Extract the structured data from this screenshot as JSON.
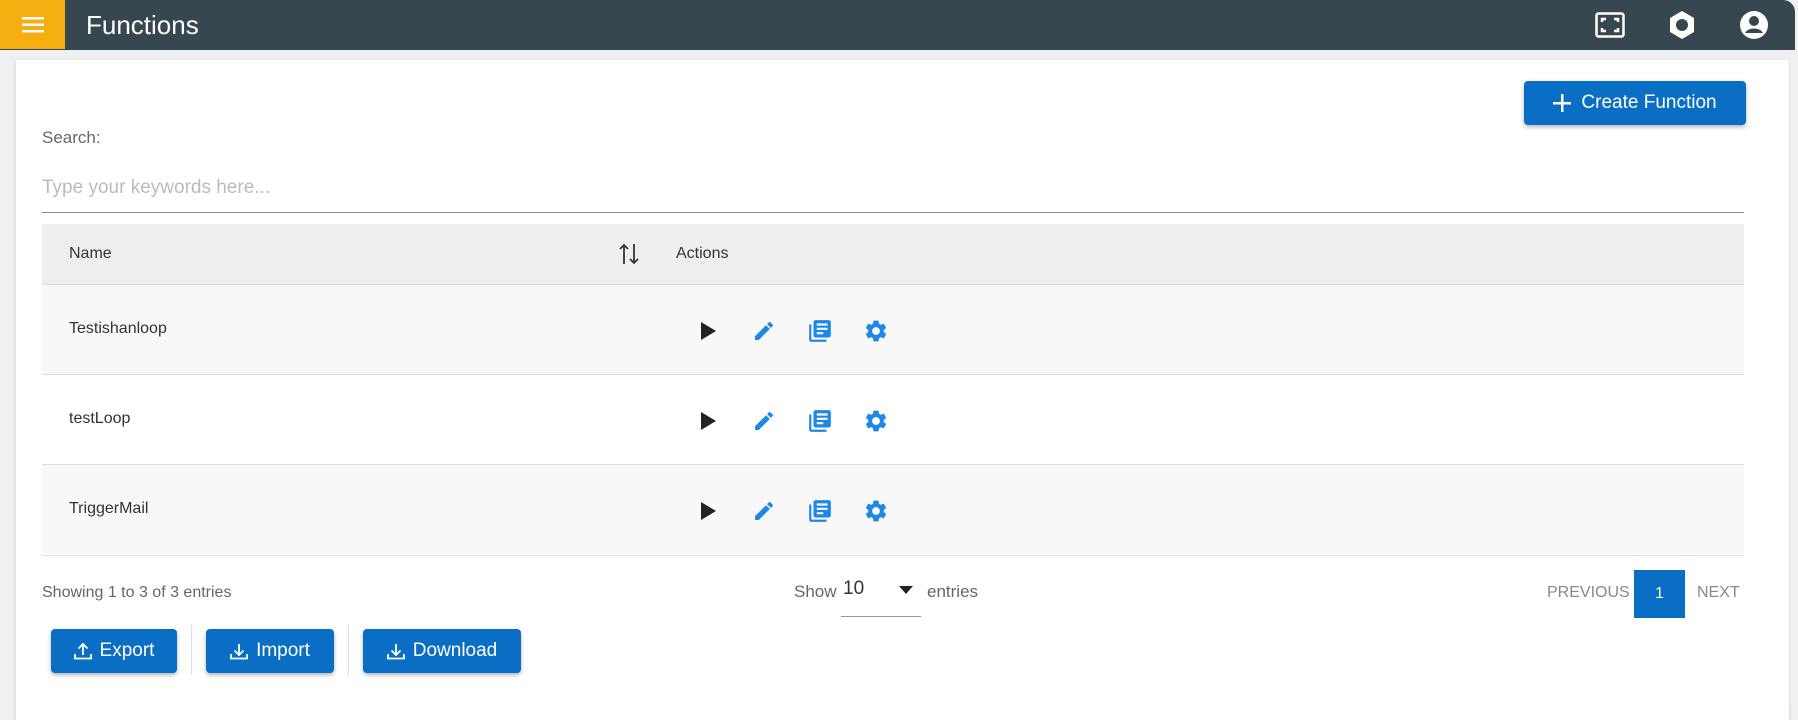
{
  "app": {
    "title": "Functions"
  },
  "colors": {
    "header": "#37474f",
    "menu": "#f5ae0f",
    "primary": "#0a6fc4",
    "action_icon": "#1e88e5"
  },
  "header_icons": [
    "fullscreen-icon",
    "settings-icon",
    "account-icon"
  ],
  "toolbar": {
    "create_label": "Create Function"
  },
  "search": {
    "label": "Search:",
    "placeholder": "Type your keywords here...",
    "value": ""
  },
  "table": {
    "columns": [
      "Name",
      "Actions"
    ],
    "rows": [
      {
        "name": "Testishanloop"
      },
      {
        "name": "testLoop"
      },
      {
        "name": "TriggerMail"
      }
    ],
    "row_actions": [
      "play-icon",
      "edit-icon",
      "library-icon",
      "settings-icon"
    ]
  },
  "footer": {
    "info": "Showing 1 to 3 of 3 entries",
    "show_label": "Show",
    "entries_value": "10",
    "entries_label": "entries",
    "prev_label": "PREVIOUS",
    "page": "1",
    "next_label": "NEXT"
  },
  "buttons": {
    "export": "Export",
    "import": "Import",
    "download": "Download"
  }
}
